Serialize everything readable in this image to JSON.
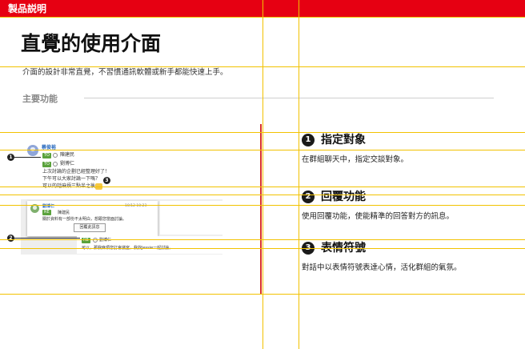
{
  "header": {
    "title": "製品説明"
  },
  "page": {
    "title": "直覺的使用介面",
    "description": "介面的設計非常直覺，不習慣通訊軟體或新手都能快速上手。",
    "section_label": "主要功能"
  },
  "screenshot": {
    "sender_name": "蔡俊裕",
    "to_tag_1": "TO",
    "to_name_1": "陳建民",
    "to_tag_2": "TO",
    "to_name_2": "劉博仁",
    "message_line_1": "上次討論的企劃已經整理好了！",
    "message_line_2": "下午可以大家討論一下嗎？",
    "message_line_3": "可以的話麻煩三點半之後",
    "popup_sender": "劉博仁",
    "popup_time": "10/12 10:23",
    "popup_re_name": "陳建民",
    "popup_text": "關於資料有一部份不太明白，想跟您當面討論。",
    "reply_button": "回覆此訊息",
    "bottom_re_tag": "RE",
    "bottom_re_name": "劉博仁",
    "bottom_text": "可以，那我麻煩您訂會議室，我找Jessie一起討論。",
    "callout_1": "1",
    "callout_2": "2",
    "callout_3": "3"
  },
  "features": [
    {
      "number": "1",
      "title": "指定對象",
      "description": "在群組聊天中，指定交談對象。"
    },
    {
      "number": "2",
      "title": "回覆功能",
      "description": "使用回覆功能，使能精準的回答對方的訊息。"
    },
    {
      "number": "3",
      "title": "表情符號",
      "description": "對話中以表情符號表達心情，活化群組的氣氛。"
    }
  ],
  "colors": {
    "header_red": "#e60012",
    "guide_yellow": "#f2c200",
    "divider_red": "#d9322b",
    "to_tag_green": "#5aa23c"
  }
}
